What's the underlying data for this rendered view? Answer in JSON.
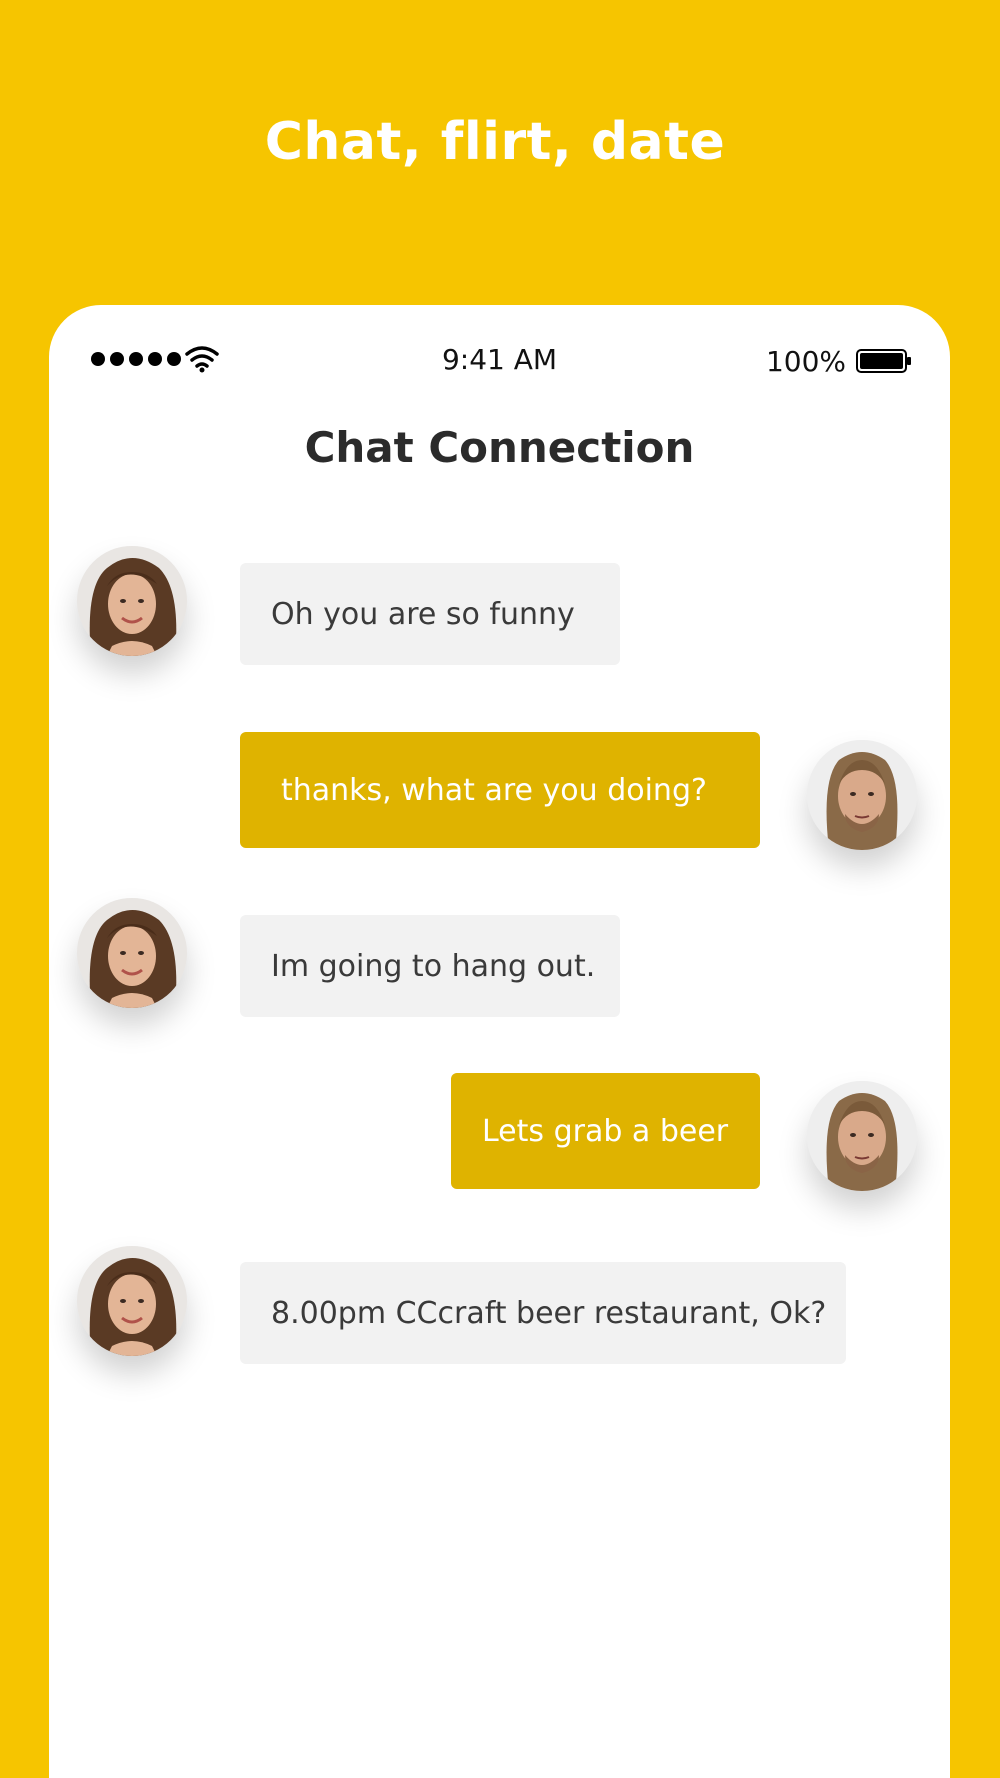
{
  "promo": {
    "title": "Chat, flirt, date"
  },
  "status_bar": {
    "time": "9:41 AM",
    "battery_percent": "100%",
    "signal_icon": "signal-dots-icon",
    "wifi_icon": "wifi-icon",
    "battery_icon": "battery-full-icon"
  },
  "header": {
    "title": "Chat Connection"
  },
  "messages": [
    {
      "sender": "her",
      "text": "Oh you are so funny"
    },
    {
      "sender": "him",
      "text": "thanks,  what are you doing?"
    },
    {
      "sender": "her",
      "text": "Im going to hang out."
    },
    {
      "sender": "him",
      "text": "Lets grab a beer"
    },
    {
      "sender": "her",
      "text": "8.00pm CCcraft beer restaurant, Ok?"
    }
  ],
  "colors": {
    "background": "#F6C500",
    "outgoing_bubble": "#DFB300",
    "incoming_bubble": "#F2F2F2",
    "title_text": "#2B2B2B"
  }
}
